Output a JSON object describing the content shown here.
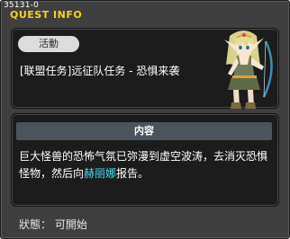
{
  "window": {
    "quest_id": "35131-0",
    "title": "QUEST INFO"
  },
  "quest": {
    "category": "活動",
    "title": "[联盟任务]远征队任务 - 恐惧来袭"
  },
  "content": {
    "header": "内容",
    "desc_before": "巨大怪兽的恐怖气氛已弥漫到虚空波涛，去消灭恐惧怪物，然后向",
    "npc_name": "赫丽娜",
    "desc_after": "报告。"
  },
  "status": {
    "text": "狀態： 可開始"
  },
  "colors": {
    "title_yellow": "#f5d31a",
    "npc_cyan": "#48e0f0",
    "panel_bg": "#1c1c1c",
    "window_bg": "#3f3f3f"
  }
}
